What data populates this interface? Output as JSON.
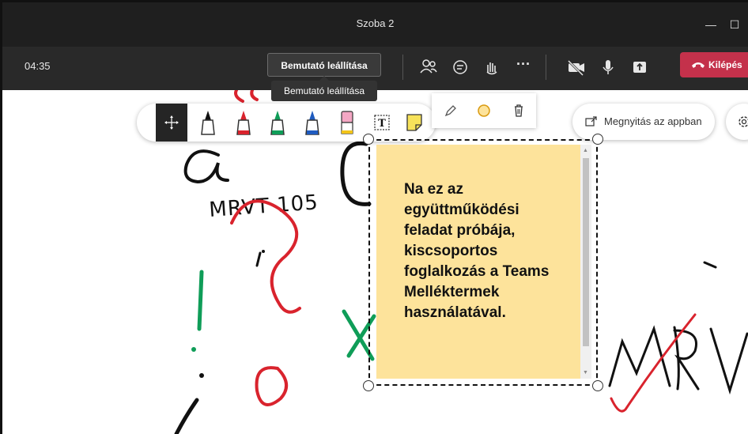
{
  "window": {
    "title": "Szoba 2"
  },
  "meeting": {
    "timer": "04:35",
    "stop_presenting_label": "Bemutató leállítása",
    "tooltip": "Bemutató leállítása",
    "leave_label": "Kilépés",
    "icons": [
      "participants-icon",
      "chat-icon",
      "raise-hand-icon",
      "more-icon",
      "camera-off-icon",
      "microphone-icon",
      "share-icon",
      "phone-hangup-icon"
    ]
  },
  "whiteboard": {
    "tools": [
      "move-icon",
      "pen-black-icon",
      "pen-red-icon",
      "pen-green-icon",
      "pen-blue-icon",
      "highlighter-icon",
      "text-tool-icon",
      "sticky-note-icon"
    ],
    "selected_tool": "move-icon",
    "open_in_app_label": "Megnyitás az appban",
    "sticky_note_text": "Na ez az együttműködési feladat próbája, kiscsoportos foglalkozás a Teams Melléktermek használatával.",
    "sticky_note_color": "#fde39b",
    "handwriting_code": "MRVT 105",
    "colors": {
      "ink_black": "#111111",
      "ink_red": "#d9232d",
      "ink_green": "#0f9d58",
      "leave_red": "#c4314b"
    }
  }
}
